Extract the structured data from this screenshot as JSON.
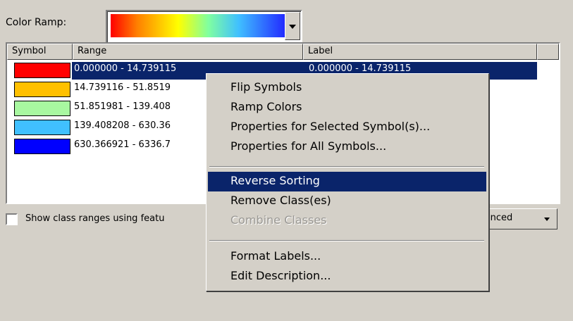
{
  "color_ramp": {
    "label": "Color Ramp:"
  },
  "table": {
    "headers": [
      "Symbol",
      "Range",
      "Label"
    ],
    "rows": [
      {
        "color": "#ff0000",
        "range": "0.000000 - 14.739115",
        "label": "0.000000 - 14.739115"
      },
      {
        "color": "#ffc000",
        "range": "14.739116 - 51.8519",
        "label": ""
      },
      {
        "color": "#a8f8a0",
        "range": "51.851981 - 139.408",
        "label": ""
      },
      {
        "color": "#40c0ff",
        "range": "139.408208 - 630.36",
        "label": ""
      },
      {
        "color": "#0000ff",
        "range": "630.366921 - 6336.7",
        "label": ""
      }
    ]
  },
  "show_class_ranges": {
    "label": "Show class ranges using featu",
    "checked": false
  },
  "advanced_button": {
    "label": "vanced"
  },
  "context_menu": {
    "items": [
      {
        "label": "Flip Symbols"
      },
      {
        "label": "Ramp Colors"
      },
      {
        "label": "Properties for Selected Symbol(s)..."
      },
      {
        "label": "Properties for All Symbols..."
      },
      {
        "label": "Reverse Sorting",
        "highlighted": true
      },
      {
        "label": "Remove Class(es)"
      },
      {
        "label": "Combine Classes",
        "disabled": true
      },
      {
        "label": "Format Labels..."
      },
      {
        "label": "Edit Description..."
      }
    ]
  }
}
